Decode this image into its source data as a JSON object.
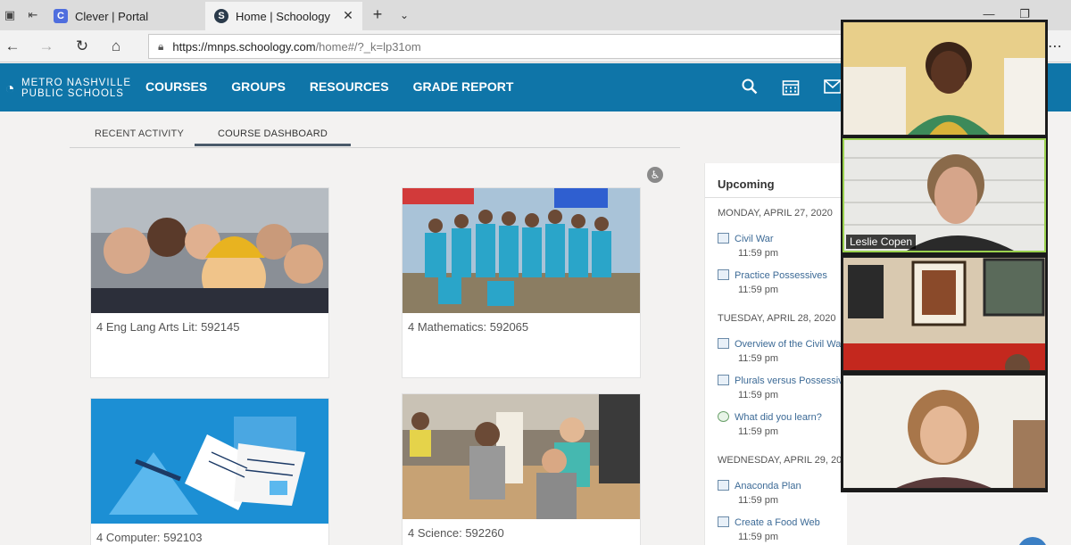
{
  "browser": {
    "tabs": [
      {
        "title": "Clever | Portal",
        "favicon": "C"
      },
      {
        "title": "Home | Schoology",
        "favicon": "S"
      }
    ],
    "url": {
      "host": "https://mnps.schoology.com",
      "path": "/home#/?_k=lp31om"
    }
  },
  "header": {
    "logo": {
      "line1": "METRO NASHVILLE",
      "line2": "PUBLIC SCHOOLS"
    },
    "nav": [
      "COURSES",
      "GROUPS",
      "RESOURCES",
      "GRADE REPORT"
    ],
    "accent": "#0f75a8"
  },
  "subtabs": {
    "recent": "RECENT ACTIVITY",
    "dashboard": "COURSE DASHBOARD"
  },
  "courses": [
    {
      "title": "4 Eng Lang Arts Lit: 592145"
    },
    {
      "title": "4 Mathematics: 592065"
    },
    {
      "title": "4 Computer: 592103"
    },
    {
      "title": "4 Science: 592260"
    }
  ],
  "upcoming": {
    "title": "Upcoming",
    "days": [
      {
        "date": "MONDAY, APRIL 27, 2020",
        "items": [
          {
            "name": "Civil War",
            "time": "11:59 pm",
            "icon": "assignment-icon"
          },
          {
            "name": "Practice Possessives",
            "time": "11:59 pm",
            "icon": "assignment-icon"
          }
        ]
      },
      {
        "date": "TUESDAY, APRIL 28, 2020",
        "items": [
          {
            "name": "Overview of the Civil War",
            "time": "11:59 pm",
            "icon": "assignment-icon"
          },
          {
            "name": "Plurals versus Possessives",
            "time": "11:59 pm",
            "icon": "assignment-icon"
          },
          {
            "name": "What did you learn?",
            "time": "11:59 pm",
            "icon": "discussion-icon"
          }
        ]
      },
      {
        "date": "WEDNESDAY, APRIL 29, 2020",
        "items": [
          {
            "name": "Anaconda Plan",
            "time": "11:59 pm",
            "icon": "assignment-icon"
          },
          {
            "name": "Create a Food Web",
            "time": "11:59 pm",
            "icon": "assignment-icon"
          }
        ]
      }
    ]
  },
  "video_call": {
    "participants": [
      {
        "name": ""
      },
      {
        "name": "Leslie Copen"
      },
      {
        "name": ""
      },
      {
        "name": ""
      }
    ],
    "active_color": "#9bd24e"
  }
}
